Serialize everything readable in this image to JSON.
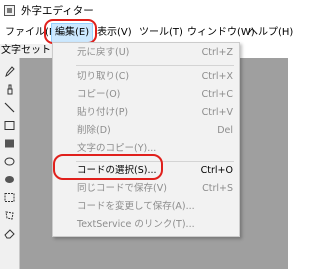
{
  "window": {
    "title": "外字エディター",
    "icon": "app-icon"
  },
  "menubar": {
    "items": [
      {
        "label": "ファイル(F)"
      },
      {
        "label": "編集(E)"
      },
      {
        "label": "表示(V)"
      },
      {
        "label": "ツール(T)"
      },
      {
        "label": "ウィンドウ(W)"
      },
      {
        "label": "ヘルプ(H)"
      }
    ],
    "active": "編集(E)"
  },
  "subbar": {
    "label": "文字セット"
  },
  "edit_menu": {
    "items": [
      {
        "label": "元に戻す(U)",
        "shortcut": "Ctrl+Z",
        "enabled": false
      },
      {
        "label": "切り取り(C)",
        "shortcut": "Ctrl+X",
        "enabled": false
      },
      {
        "label": "コピー(O)",
        "shortcut": "Ctrl+C",
        "enabled": false
      },
      {
        "label": "貼り付け(P)",
        "shortcut": "Ctrl+V",
        "enabled": false
      },
      {
        "label": "削除(D)",
        "shortcut": "Del",
        "enabled": false
      },
      {
        "label": "文字のコピー(Y)...",
        "shortcut": "",
        "enabled": false
      },
      {
        "label": "コードの選択(S)...",
        "shortcut": "Ctrl+O",
        "enabled": true
      },
      {
        "label": "同じコードで保存(V)",
        "shortcut": "Ctrl+S",
        "enabled": false
      },
      {
        "label": "コードを変更して保存(A)...",
        "shortcut": "",
        "enabled": false
      },
      {
        "label": "TextService のリンク(T)...",
        "shortcut": "",
        "enabled": false
      }
    ]
  },
  "tools": [
    "pencil-icon",
    "brush-icon",
    "line-icon",
    "hollow-rectangle-icon",
    "filled-rectangle-icon",
    "hollow-ellipse-icon",
    "filled-ellipse-icon",
    "rectangle-select-icon",
    "freeform-select-icon",
    "eraser-icon"
  ],
  "colors": {
    "highlight_ring": "#e0201c",
    "menu_active_bg": "#cce8ff",
    "canvas_bg": "#9f9f9f",
    "disabled_text": "#8d8d8d"
  }
}
